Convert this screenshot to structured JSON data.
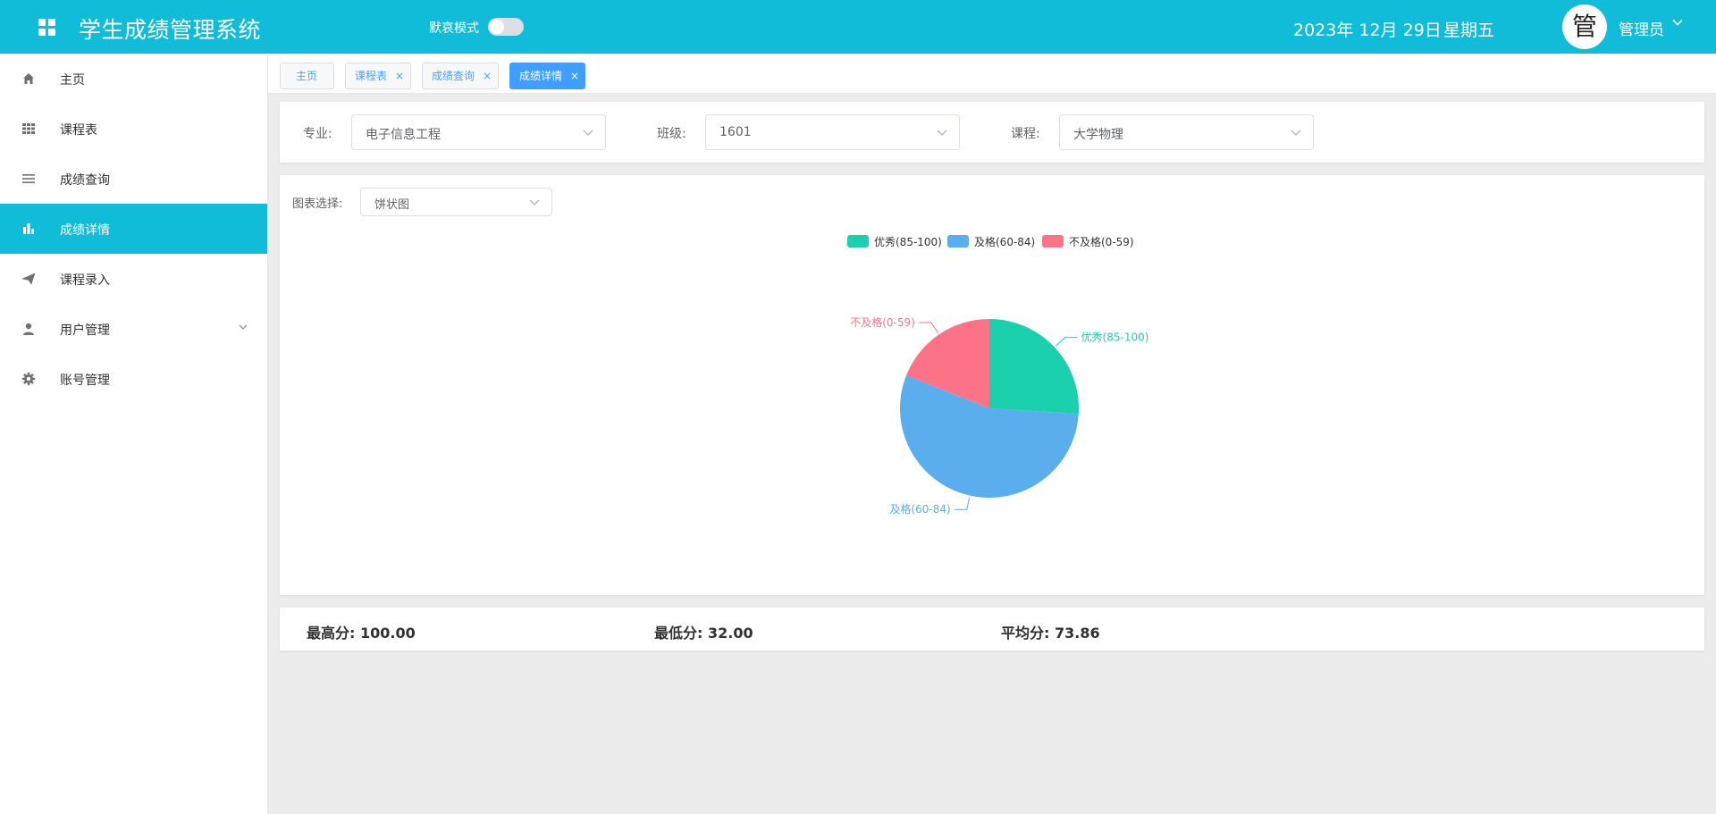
{
  "header": {
    "title": "学生成绩管理系统",
    "dark_mode_label": "默哀模式",
    "date": "2023年 12月 29日",
    "weekday": "星期五",
    "avatar_char": "管",
    "user_name": "管理员"
  },
  "sidebar": {
    "items": [
      {
        "label": "主页",
        "icon": "home-icon"
      },
      {
        "label": "课程表",
        "icon": "grid-icon"
      },
      {
        "label": "成绩查询",
        "icon": "list-icon"
      },
      {
        "label": "成绩详情",
        "icon": "bar-chart-icon",
        "active": true
      },
      {
        "label": "课程录入",
        "icon": "paper-plane-icon"
      },
      {
        "label": "用户管理",
        "icon": "user-icon",
        "has_submenu": true
      },
      {
        "label": "账号管理",
        "icon": "gear-icon"
      }
    ]
  },
  "tabs": [
    {
      "label": "主页",
      "closable": false
    },
    {
      "label": "课程表",
      "closable": true
    },
    {
      "label": "成绩查询",
      "closable": true
    },
    {
      "label": "成绩详情",
      "closable": true,
      "active": true
    }
  ],
  "tab_close_glyph": "×",
  "filters": {
    "major_label": "专业:",
    "major_value": "电子信息工程",
    "class_label": "班级:",
    "class_value": "1601",
    "course_label": "课程:",
    "course_value": "大学物理"
  },
  "chart_select": {
    "label": "图表选择:",
    "value": "饼状图"
  },
  "chart_data": {
    "type": "pie",
    "title": "",
    "legend_position": "top-center",
    "slices": [
      {
        "name": "优秀(85-100)",
        "value": 26,
        "color": "#1bd1ad"
      },
      {
        "name": "及格(60-84)",
        "value": 55,
        "color": "#5aaeed"
      },
      {
        "name": "不及格(0-59)",
        "value": 19,
        "color": "#fc7388"
      }
    ]
  },
  "stats": {
    "max": "最高分:  100.00",
    "min": "最低分:  32.00",
    "avg": "平均分:  73.86"
  },
  "colors": {
    "primary": "#10bcd7",
    "tab_active": "#409eff"
  }
}
